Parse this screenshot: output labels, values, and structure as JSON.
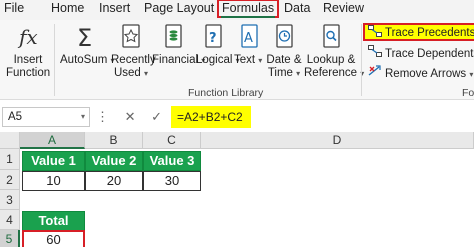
{
  "tabs": [
    "File",
    "Home",
    "Insert",
    "Page Layout",
    "Formulas",
    "Data",
    "Review"
  ],
  "ribbon": {
    "insert_function": [
      "Insert",
      "Function"
    ],
    "autosum": "AutoSum",
    "recently_used": [
      "Recently",
      "Used"
    ],
    "financial": "Financial",
    "logical": "Logical",
    "text": "Text",
    "date_time": [
      "Date &",
      "Time"
    ],
    "lookup_reference": [
      "Lookup &",
      "Reference"
    ],
    "group_label": "Function Library",
    "trace_precedents": "Trace Precedents",
    "trace_dependents": "Trace Dependents",
    "remove_arrows": "Remove Arrows",
    "fo_fragment": "Fo"
  },
  "formula_bar": {
    "name_box": "A5",
    "fx": "fx",
    "formula": "=A2+B2+C2"
  },
  "grid": {
    "columns": [
      "A",
      "B",
      "C",
      "D"
    ],
    "rows": [
      "1",
      "2",
      "3",
      "4",
      "5"
    ],
    "headers": [
      "Value 1",
      "Value 2",
      "Value 3"
    ],
    "values": [
      "10",
      "20",
      "30"
    ],
    "total_label": "Total",
    "total_value": "60"
  },
  "colors": {
    "accent_green": "#1aa14e",
    "highlight_yellow": "#ffff00",
    "annotation_red": "#d71f26"
  }
}
